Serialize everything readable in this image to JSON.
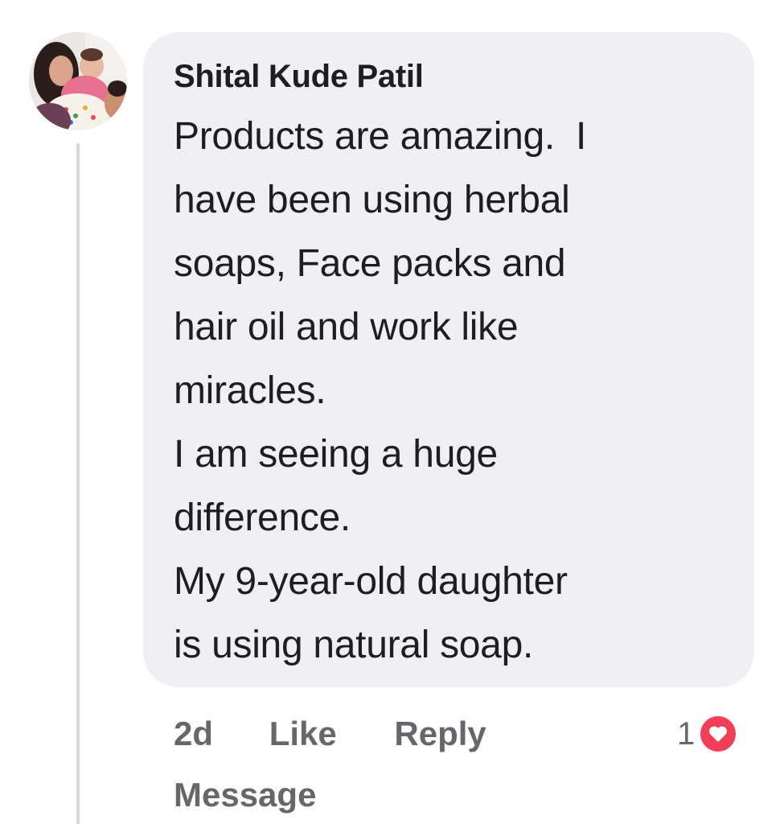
{
  "comment": {
    "author": "Shital Kude Patil",
    "body_lines": [
      "Products are amazing.  I",
      "have been using herbal",
      "soaps, Face packs and",
      "hair oil and work like",
      "miracles.",
      "I am seeing a huge",
      "difference.",
      "My 9-year-old daughter",
      "is using natural soap."
    ],
    "timestamp": "2d",
    "like_label": "Like",
    "reply_label": "Reply",
    "message_label": "Message",
    "reaction_count": "1",
    "reaction_icon": "heart-icon"
  },
  "colors": {
    "bubble_background": "#eff0f4",
    "action_text": "#65676b",
    "heart": "#f33e58"
  }
}
